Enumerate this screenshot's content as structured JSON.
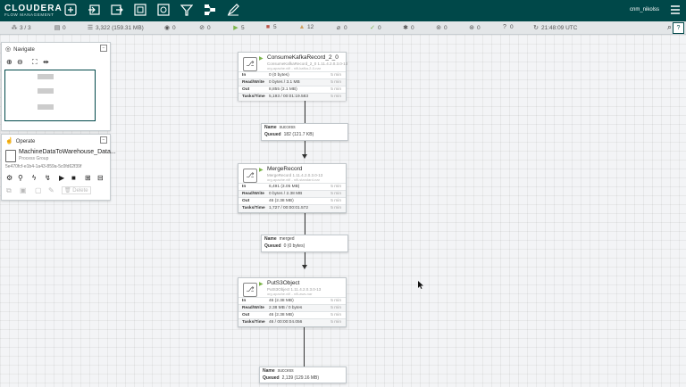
{
  "header": {
    "logo": "CLOUDERA",
    "logo_sub": "FLOW MANAGEMENT",
    "user": "cnm_nikolss",
    "toolbar_icons": [
      "processor-icon",
      "input-port-icon",
      "output-port-icon",
      "process-group-icon",
      "remote-process-group-icon",
      "funnel-icon",
      "template-icon",
      "label-icon"
    ]
  },
  "status": {
    "clusters": "3 / 3",
    "threads": "0",
    "queued": "3,322 (159.31 MB)",
    "transmitting": "0",
    "not_transmitting": "0",
    "running": "5",
    "stopped": "5",
    "invalid": "12",
    "disabled": "0",
    "up_to_date": "0",
    "locally_modified": "0",
    "stale": "0",
    "modified_stale": "0",
    "sync_failure": "0",
    "refresh_time": "21:48:09 UTC"
  },
  "navigate": {
    "title": "Navigate"
  },
  "operate": {
    "title": "Operate",
    "name": "MachineDataToWarehouse_Data...",
    "type": "Process Group",
    "id": "5e470fcf-e1b4-1a43-859a-5c0fd62f39f",
    "delete_label": "Delete"
  },
  "processors": [
    {
      "name": "ConsumeKafkaRecord_2_0",
      "type": "ConsumeKafkaRecord_2_0 1.11.4.2.0.3.0-13",
      "bundle": "org.apache.nifi - nifi-kafka-2-0-nar",
      "in": "0 (0 bytes)",
      "rw": "0 bytes / 3.1 MB",
      "out": "8,855 (3.1 MB)",
      "tasks": "5,193 / 00:01:19.583",
      "five": "5 min"
    },
    {
      "name": "MergeRecord",
      "type": "MergeRecord 1.11.4.2.0.3.0-13",
      "bundle": "org.apache.nifi - nifi-standard-nar",
      "in": "6,491 (3.05 MB)",
      "rw": "0 bytes / 2.38 MB",
      "out": "46 (2.38 MB)",
      "tasks": "1,727 / 00:00:01.572",
      "five": "5 min"
    },
    {
      "name": "PutS3Object",
      "type": "PutS3Object 1.11.4.2.0.3.0-13",
      "bundle": "org.apache.nifi - nifi-aws-nar",
      "in": "46 (2.38 MB)",
      "rw": "2.38 MB / 0 bytes",
      "out": "46 (2.38 MB)",
      "tasks": "46 / 00:00:04.056",
      "five": "5 min"
    }
  ],
  "row_labels": {
    "in": "In",
    "rw": "Read/Write",
    "out": "Out",
    "tasks": "Tasks/Time"
  },
  "connections": [
    {
      "name_label": "Name",
      "name": "success",
      "queued_label": "Queued",
      "queued": "182 (121.7 KB)"
    },
    {
      "name_label": "Name",
      "name": "merged",
      "queued_label": "Queued",
      "queued": "0 (0 bytes)"
    },
    {
      "name_label": "Name",
      "name": "success",
      "queued_label": "Queued",
      "queued": "2,139 (129.16 MB)"
    }
  ],
  "colors": {
    "header": "#004849",
    "running": "#7bb44a",
    "stopped": "#ba554a",
    "invalid": "#cf9f5d"
  }
}
